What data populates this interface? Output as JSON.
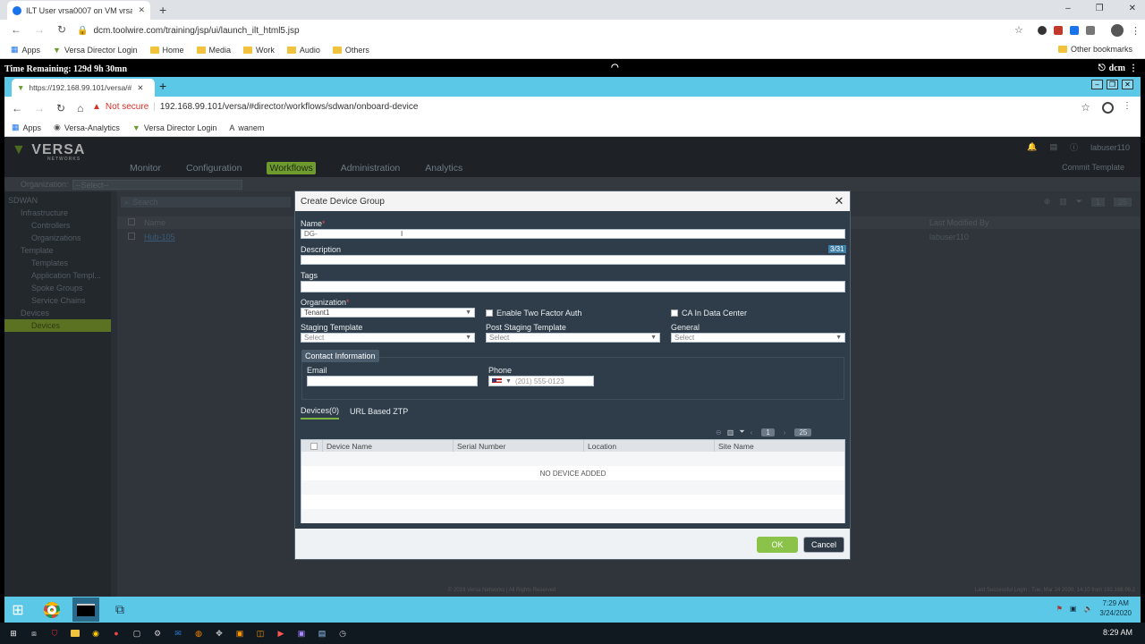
{
  "outer_browser": {
    "tab_title": "ILT User vrsa0007 on VM vrsa000",
    "url": "dcm.toolwire.com/training/jsp/ui/launch_ilt_html5.jsp",
    "bookmarks": [
      "Apps",
      "Versa Director Login",
      "Home",
      "Media",
      "Work",
      "Audio",
      "Others"
    ],
    "other_bookmarks": "Other bookmarks",
    "window_controls": [
      "–",
      "❐",
      "✕"
    ]
  },
  "session": {
    "time_remaining": "Time Remaining: 129d 9h 30mn",
    "user": "dcm"
  },
  "inner_browser": {
    "tab_title": "https://192.168.99.101/versa/#di",
    "not_secure": "Not secure",
    "url": "192.168.99.101/versa/#director/workflows/sdwan/onboard-device",
    "bookmarks": [
      "Apps",
      "Versa-Analytics",
      "Versa Director Login",
      "wanem"
    ]
  },
  "app": {
    "logo": "VERSA",
    "logo_sub": "NETWORKS",
    "nav": [
      "Monitor",
      "Configuration",
      "Workflows",
      "Administration",
      "Analytics"
    ],
    "nav_active": "Workflows",
    "user": "labuser110",
    "commit_template": "Commit Template",
    "org_label": "Organization:",
    "org_value": "--Select--",
    "sidebar": [
      {
        "label": "SDWAN",
        "level": 1
      },
      {
        "label": "Infrastructure",
        "level": 2
      },
      {
        "label": "Controllers",
        "level": 3
      },
      {
        "label": "Organizations",
        "level": 3
      },
      {
        "label": "Template",
        "level": 2
      },
      {
        "label": "Templates",
        "level": 3
      },
      {
        "label": "Application Templ...",
        "level": 3
      },
      {
        "label": "Spoke Groups",
        "level": 3
      },
      {
        "label": "Service Chains",
        "level": 3
      },
      {
        "label": "Devices",
        "level": 2
      },
      {
        "label": "Devices",
        "level": 3,
        "selected": true
      }
    ],
    "list": {
      "search_placeholder": "Search",
      "col_name": "Name",
      "col_modified": "Last Modified By",
      "row_name": "Hub-105",
      "row_modified": "labuser110",
      "page": "1",
      "page_size": "25"
    },
    "footer_left": "© 2019 Versa Networks | All Rights Reserved",
    "footer_right": "Last Successful Login : Tue, Mar 24 2020, 14:10 from 192.168.99.2"
  },
  "modal": {
    "title": "Create Device Group",
    "name_label": "Name",
    "name_value": "DG-",
    "description_label": "Description",
    "counter": "3/31",
    "tags_label": "Tags",
    "organization_label": "Organization",
    "organization_value": "Tenant1",
    "two_factor_label": "Enable Two Factor Auth",
    "ca_label": "CA In Data Center",
    "staging_label": "Staging Template",
    "staging_value": "Select",
    "post_staging_label": "Post Staging Template",
    "post_staging_value": "Select",
    "general_label": "General",
    "general_value": "Select",
    "contact_title": "Contact Information",
    "email_label": "Email",
    "phone_label": "Phone",
    "phone_placeholder": "(201) 555-0123",
    "tabs": [
      "Devices(0)",
      "URL Based ZTP"
    ],
    "page": "1",
    "page_size": "25",
    "columns": [
      "Device Name",
      "Serial Number",
      "Location",
      "Site Name"
    ],
    "empty_text": "NO DEVICE ADDED",
    "ok": "OK",
    "cancel": "Cancel"
  },
  "inner_taskbar": {
    "time": "7:29 AM",
    "date": "3/24/2020"
  },
  "outer_taskbar": {
    "time": "8:29 AM"
  }
}
